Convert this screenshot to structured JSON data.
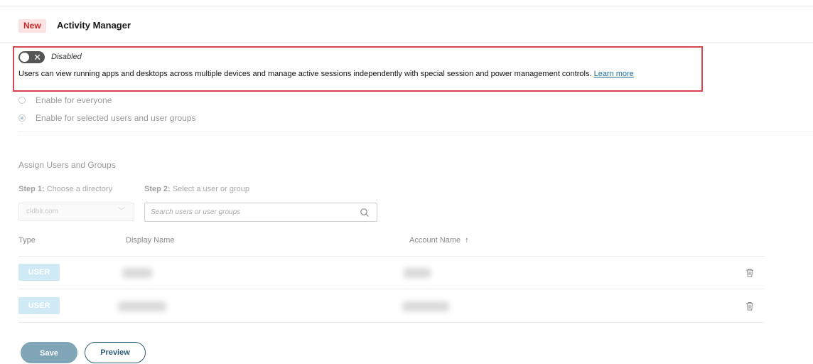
{
  "header": {
    "badge": "New",
    "title": "Activity Manager"
  },
  "toggle": {
    "state_label": "Disabled",
    "enabled": false
  },
  "description": {
    "text": "Users can view running apps and desktops across multiple devices and manage active sessions independently with special session and power management controls.",
    "link": "Learn more"
  },
  "options": [
    {
      "label": "Enable for everyone",
      "selected": false
    },
    {
      "label": "Enable for selected users and user groups",
      "selected": true
    }
  ],
  "assign": {
    "title": "Assign Users and Groups",
    "step1_prefix": "Step 1:",
    "step1_text": "Choose a directory",
    "step2_prefix": "Step 2:",
    "step2_text": "Select a user or group",
    "directory_value": "cldblr.com",
    "search_placeholder": "Search users or user groups"
  },
  "table": {
    "columns": [
      "Type",
      "Display Name",
      "Account Name"
    ],
    "rows": [
      {
        "type": "USER"
      },
      {
        "type": "USER"
      }
    ]
  },
  "actions": {
    "save": "Save",
    "preview": "Preview"
  },
  "icons": {
    "close": "close-icon",
    "search": "search-icon",
    "trash": "trash-icon",
    "sort": "sort-up-icon",
    "chevron": "chevron-down-icon"
  },
  "colors": {
    "highlight_border": "#d64550",
    "badge_bg": "#fbe3e3",
    "badge_text": "#c62828",
    "link": "#1f6e9c",
    "save_bg": "#7fa5b6",
    "preview_border": "#2e5d77",
    "user_badge_bg": "#cfe9f5"
  }
}
